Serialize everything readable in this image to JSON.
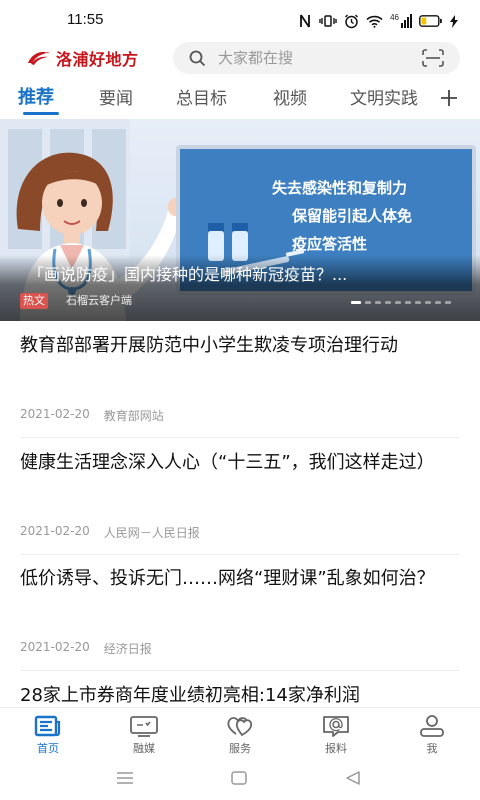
{
  "status_bar": {
    "time": "11:55",
    "network": "46",
    "battery_level": 0.3
  },
  "header": {
    "logo_text": "洛浦好地方"
  },
  "search": {
    "placeholder": "大家都在搜"
  },
  "tabs": [
    {
      "label": "推荐",
      "active": true
    },
    {
      "label": "要闻",
      "active": false
    },
    {
      "label": "总目标",
      "active": false
    },
    {
      "label": "视频",
      "active": false
    },
    {
      "label": "文明实践",
      "active": false
    }
  ],
  "tab_add_icon": "plus-icon",
  "banner": {
    "board_lines": [
      "失去感染性和复制力",
      "保留能引起人体免",
      "疫应答活性"
    ],
    "title": "「画说防疫」国内接种的是哪种新冠疫苗？...",
    "badge": "热文",
    "source": "石榴云客户端",
    "slide_count": 10,
    "active_slide": 1
  },
  "news": [
    {
      "title": "教育部部署开展防范中小学生欺凌专项治理行动",
      "date": "2021-02-20",
      "source": "教育部网站"
    },
    {
      "title": "健康生活理念深入人心（“十三五”，我们这样走过）",
      "date": "2021-02-20",
      "source": "人民网－人民日报"
    },
    {
      "title": "低价诱导、投诉无门……网络“理财课”乱象如何治？",
      "date": "2021-02-20",
      "source": "经济日报"
    },
    {
      "title": "28家上市券商年度业绩初亮相:14家净利润",
      "date": "",
      "source": ""
    }
  ],
  "bottom_nav": [
    {
      "label": "首页",
      "icon": "home-icon",
      "active": true
    },
    {
      "label": "融媒",
      "icon": "media-icon",
      "active": false
    },
    {
      "label": "服务",
      "icon": "service-icon",
      "active": false
    },
    {
      "label": "报料",
      "icon": "report-icon",
      "active": false
    },
    {
      "label": "我",
      "icon": "user-icon",
      "active": false
    }
  ],
  "colors": {
    "accent": "#1a73c8",
    "brand": "#c8161d",
    "hot_badge": "#d9534f"
  }
}
